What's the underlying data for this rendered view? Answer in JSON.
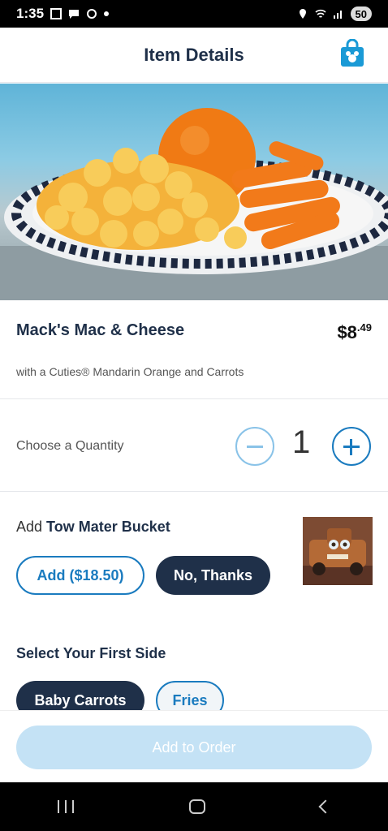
{
  "status_bar": {
    "time": "1:35",
    "battery": "50"
  },
  "header": {
    "title": "Item Details",
    "bag_icon": "shopping-bag-icon"
  },
  "item": {
    "name": "Mack's Mac & Cheese",
    "price_dollars": "$8",
    "price_cents": ".49",
    "description": "with a Cuties® Mandarin Orange and Carrots"
  },
  "quantity": {
    "label": "Choose a Quantity",
    "value": "1"
  },
  "addon": {
    "prefix": "Add",
    "name": "Tow Mater Bucket",
    "add_label": "Add ($18.50)",
    "decline_label": "No, Thanks"
  },
  "side": {
    "title": "Select Your First Side",
    "options": [
      "Baby Carrots",
      "Fries"
    ]
  },
  "footer": {
    "order_label": "Add to Order"
  },
  "colors": {
    "navy": "#1f3049",
    "accent": "#1a7bbf",
    "disabled": "#c4e2f5"
  }
}
